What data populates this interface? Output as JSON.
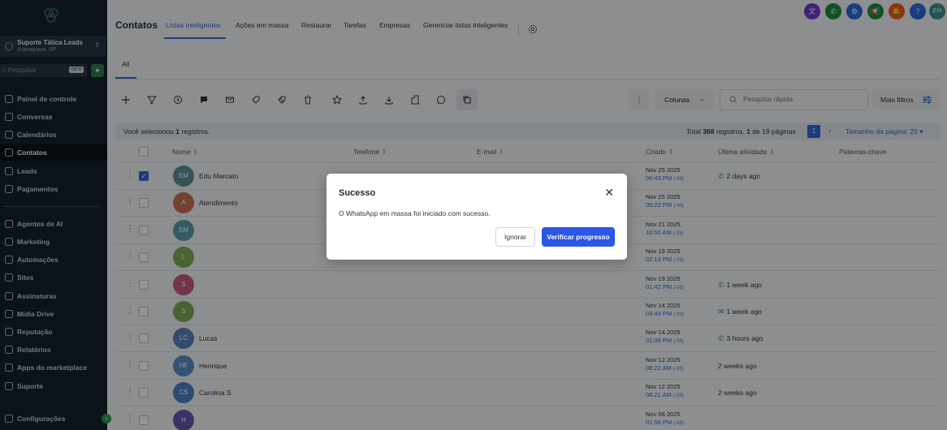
{
  "sidebar": {
    "location": {
      "name": "Suporte Tática Leads",
      "city": "Araraquara, SP"
    },
    "search": {
      "placeholder": "Pesquisar",
      "shortcut": "ctrl K"
    },
    "nav": [
      {
        "label": "Painel de controle",
        "icon": "dashboard-icon"
      },
      {
        "label": "Conversas",
        "icon": "chat-icon"
      },
      {
        "label": "Calendários",
        "icon": "calendar-icon"
      },
      {
        "label": "Contatos",
        "icon": "contacts-icon",
        "active": true
      },
      {
        "label": "Leads",
        "icon": "leads-icon"
      },
      {
        "label": "Pagamentos",
        "icon": "payments-icon"
      },
      {
        "label": "Agentes de AI",
        "icon": "ai-icon"
      },
      {
        "label": "Marketing",
        "icon": "send-icon"
      },
      {
        "label": "Automações",
        "icon": "automation-icon"
      },
      {
        "label": "Sites",
        "icon": "sites-icon"
      },
      {
        "label": "Assinaturas",
        "icon": "badge-icon"
      },
      {
        "label": "Mídia Drive",
        "icon": "media-icon"
      },
      {
        "label": "Reputação",
        "icon": "star-icon"
      },
      {
        "label": "Relatórios",
        "icon": "chart-icon"
      },
      {
        "label": "Apps do marketplace",
        "icon": "apps-icon"
      },
      {
        "label": "Suporte",
        "icon": "support-icon"
      },
      {
        "label": "Configurações",
        "icon": "gear-icon"
      }
    ]
  },
  "header": {
    "title": "Contatos",
    "tabs": [
      "Listas inteligentes",
      "Ações em massa",
      "Restaurar",
      "Tarefas",
      "Empresas",
      "Gerenciar listas inteligentes"
    ],
    "user_initials": "EM",
    "help": "?"
  },
  "subtabs": [
    "All"
  ],
  "toolbar": {
    "columns_label": "Colunas",
    "search_placeholder": "Pesquisa rápida",
    "more_filters": "Mais filtros"
  },
  "infobar": {
    "selected_prefix": "Você selecionou ",
    "selected_count": "1",
    "selected_suffix": " registros.",
    "total_prefix": "Total ",
    "total_count": "368",
    "total_mid": " registros. ",
    "page_range": "1",
    "page_of": " de 19 páginas",
    "current_page": "1",
    "page_size_label": "Tamanho da página: 20"
  },
  "table": {
    "columns": [
      "Nome",
      "Telefone",
      "E-mail",
      "Criado",
      "Última atividade",
      "Palavras-chave"
    ],
    "rows": [
      {
        "initials": "EM",
        "name": "Edu Marcato",
        "color": "#3f7f8f",
        "date": "Nov 25 2025",
        "time": "06:43 PM",
        "tz": "(-03)",
        "activity": "2 days ago",
        "act_icon": "whatsapp",
        "checked": true
      },
      {
        "initials": "A",
        "name": "Atendimento",
        "color": "#c0593a",
        "date": "Nov 25 2025",
        "time": "05:22 PM",
        "tz": "(-03)",
        "activity": "",
        "act_icon": ""
      },
      {
        "initials": "BM",
        "name": "",
        "color": "#3f8f9f",
        "date": "Nov 21 2025",
        "time": "10:50 AM",
        "tz": "(-03)",
        "activity": "",
        "act_icon": ""
      },
      {
        "initials": "L",
        "name": "",
        "color": "#6a9f3a",
        "date": "Nov 19 2025",
        "time": "02:13 PM",
        "tz": "(-03)",
        "activity": "",
        "act_icon": ""
      },
      {
        "initials": "S",
        "name": "",
        "color": "#c0406a",
        "date": "Nov 19 2025",
        "time": "01:42 PM",
        "tz": "(-03)",
        "activity": "1 week ago",
        "act_icon": "whatsapp"
      },
      {
        "initials": "S",
        "name": "",
        "color": "#6a9f3a",
        "date": "Nov 14 2025",
        "time": "03:44 PM",
        "tz": "(-03)",
        "activity": "1 week ago",
        "act_icon": "email"
      },
      {
        "initials": "LC",
        "name": "Lucas",
        "color": "#3f6fb0",
        "date": "Nov 14 2025",
        "time": "01:38 PM",
        "tz": "(-03)",
        "activity": "3 hours ago",
        "act_icon": "whatsapp"
      },
      {
        "initials": "HF",
        "name": "Henrique",
        "color": "#3f7fbf",
        "date": "Nov 12 2025",
        "time": "08:22 AM",
        "tz": "(-03)",
        "activity": "2 weeks ago",
        "act_icon": ""
      },
      {
        "initials": "CS",
        "name": "Carolina S",
        "color": "#2f6fc0",
        "date": "Nov 12 2025",
        "time": "08:21 AM",
        "tz": "(-03)",
        "activity": "2 weeks ago",
        "act_icon": ""
      },
      {
        "initials": "H",
        "name": "",
        "color": "#4a3fa0",
        "date": "Nov 06 2025",
        "time": "01:56 PM",
        "tz": "(-03)",
        "activity": "",
        "act_icon": ""
      }
    ]
  },
  "modal": {
    "title": "Sucesso",
    "body": "O WhatsApp em massa foi iniciado com sucesso.",
    "ignore_label": "Ignorar",
    "verify_label": "Verificar progresso"
  },
  "colors": {
    "accent": "#2b6ad8",
    "sidebar": "#15202d",
    "success": "#2e9a4d"
  }
}
